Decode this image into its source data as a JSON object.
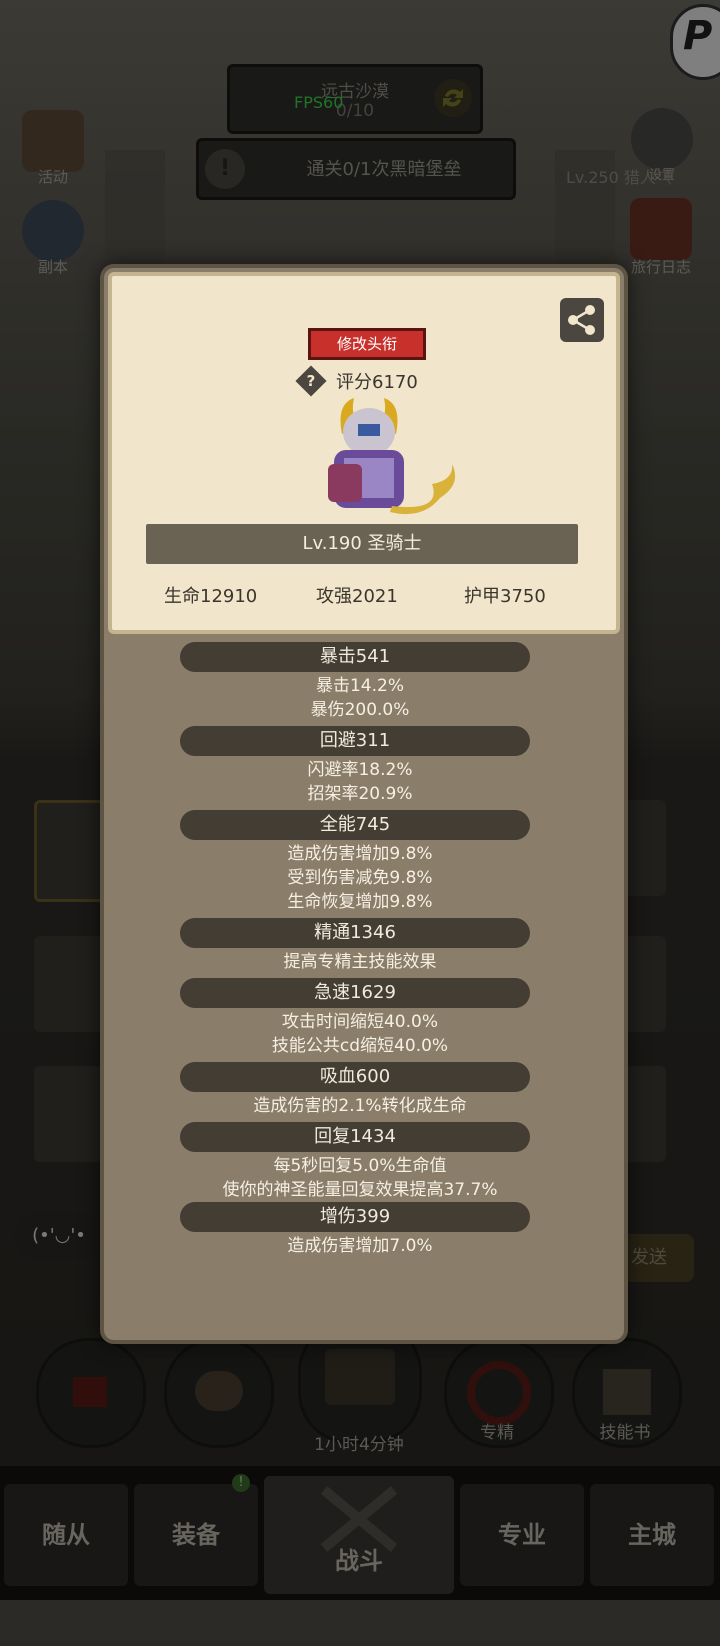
{
  "hud": {
    "fps": "FPS60",
    "zone_name": "远古沙漠",
    "zone_progress": "0/10",
    "quest_text": "通关0/1次黑暗堡垒",
    "player_label": "Lv.250 猎人（"
  },
  "side_left": [
    {
      "label": "活动",
      "icon": "scroll-icon"
    },
    {
      "label": "副本",
      "icon": "portal-icon"
    }
  ],
  "side_right": [
    {
      "label": "设置",
      "icon": "gear-icon"
    },
    {
      "label": "旅行日志",
      "icon": "book-icon"
    }
  ],
  "profile": {
    "rename_label": "修改头衔",
    "score_label": "评分6170",
    "level_class": "Lv.190 圣骑士",
    "hp": "生命12910",
    "atk": "攻强2021",
    "armor": "护甲3750"
  },
  "stats": [
    {
      "head": "暴击541",
      "lines": [
        "暴击14.2%",
        "暴伤200.0%"
      ]
    },
    {
      "head": "回避311",
      "lines": [
        "闪避率18.2%",
        "招架率20.9%"
      ]
    },
    {
      "head": "全能745",
      "lines": [
        "造成伤害增加9.8%",
        "受到伤害减免9.8%",
        "生命恢复增加9.8%"
      ]
    },
    {
      "head": "精通1346",
      "lines": [
        "提高专精主技能效果"
      ]
    },
    {
      "head": "急速1629",
      "lines": [
        "攻击时间缩短40.0%",
        "技能公共cd缩短40.0%"
      ]
    },
    {
      "head": "吸血600",
      "lines": [
        "造成伤害的2.1%转化成生命"
      ]
    },
    {
      "head": "回复1434",
      "lines": [
        "每5秒回复5.0%生命值",
        "使你的神圣能量回复效果提高37.7%"
      ]
    },
    {
      "head": "增伤399",
      "lines": [
        "造成伤害增加7.0%"
      ]
    }
  ],
  "chat": {
    "emote": "(•'◡'•",
    "send_label": "发送"
  },
  "action_buttons": {
    "chest_timer": "1小时4分钟",
    "specialization": "专精",
    "skillbook": "技能书"
  },
  "bottom_nav": [
    "随从",
    "装备",
    "战斗",
    "专业",
    "主城"
  ],
  "colors": {
    "accent_red": "#c8302c",
    "card_bg": "#f1e6cc",
    "panel_bg": "#8a7e6b",
    "fps_green": "#39d34a"
  }
}
